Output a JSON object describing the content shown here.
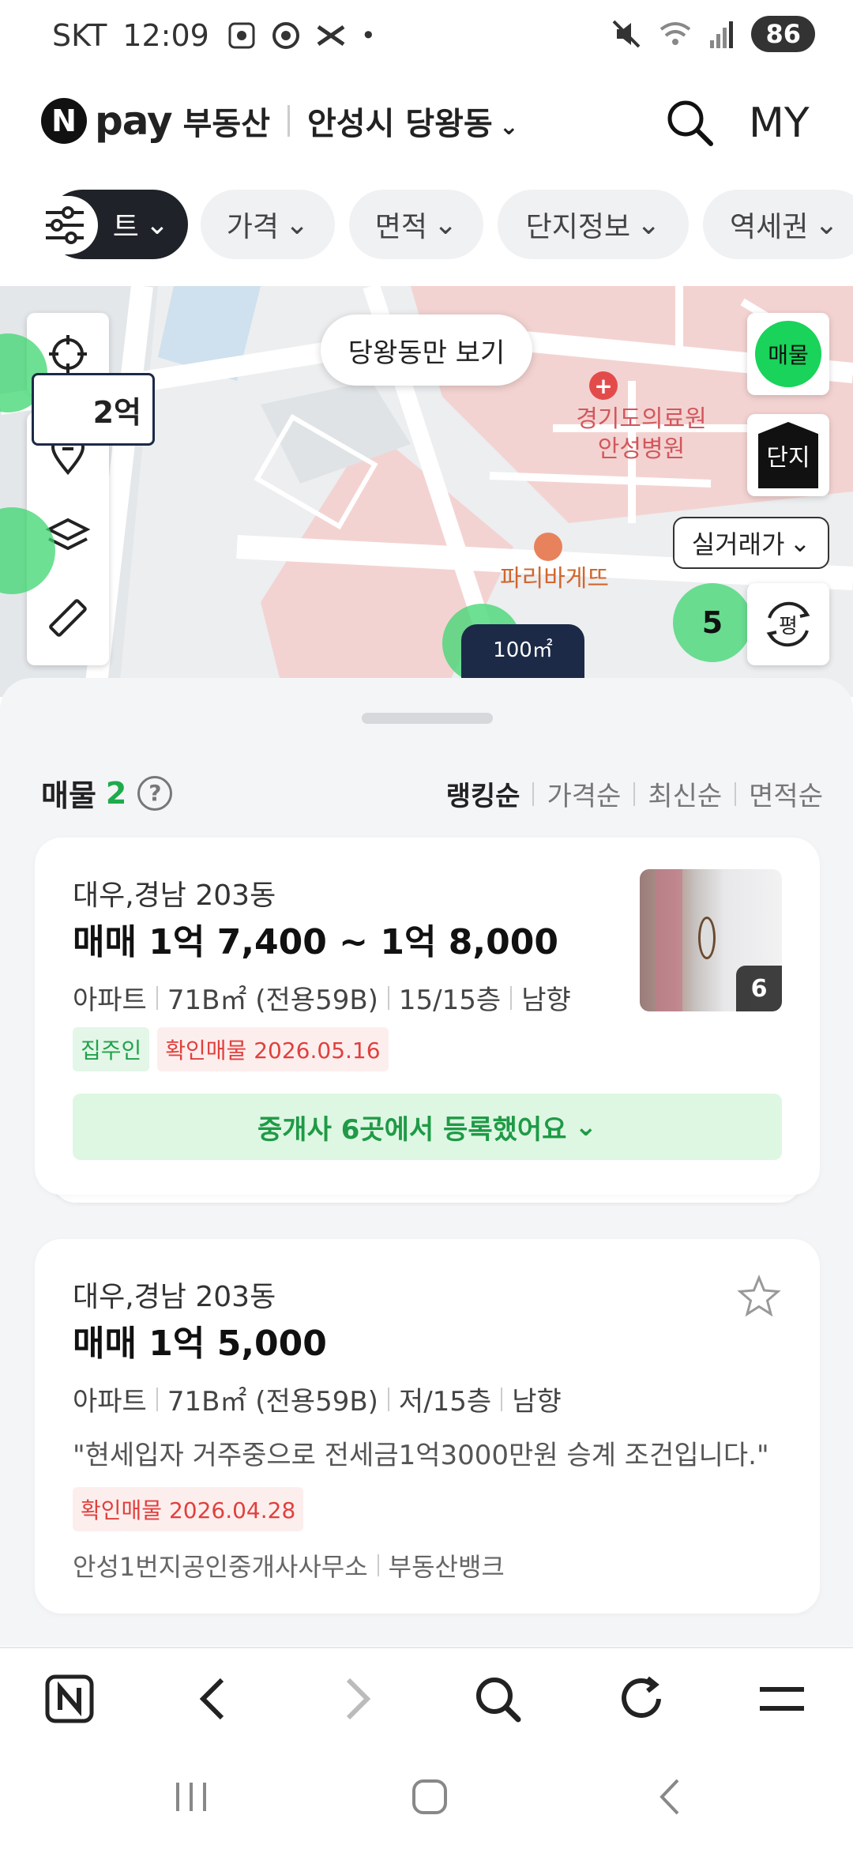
{
  "status_bar": {
    "carrier": "SKT",
    "time": "12:09",
    "battery": "86"
  },
  "header": {
    "logo_letter": "N",
    "brand": "pay",
    "service": "부동산",
    "location": "안성시 당왕동",
    "my": "MY"
  },
  "filters": [
    "트",
    "가격",
    "면적",
    "단지정보",
    "역세권"
  ],
  "map": {
    "view_only": "당왕동만 보기",
    "sale_button": "매물",
    "complex_button": "단지",
    "real_price": "실거래가",
    "pyeong_button": "평",
    "hospital_label": "경기도의료원\n안성병원",
    "bakery_label": "파리바게뜨",
    "cluster_count": "5",
    "marker_area": "100㎡",
    "left_marker_price": "2억"
  },
  "list": {
    "title": "매물",
    "count": "2",
    "sort_options": [
      "랭킹순",
      "가격순",
      "최신순",
      "면적순"
    ],
    "active_sort": "랭킹순"
  },
  "listings": [
    {
      "name": "대우,경남 203동",
      "price": "매매 1억 7,400 ~ 1억 8,000",
      "type": "아파트",
      "area": "71B㎡ (전용59B)",
      "floor": "15/15층",
      "direction": "남향",
      "tags": [
        "집주인",
        "확인매물 2026.05.16"
      ],
      "photo_count": "6",
      "agents": "중개사 6곳에서 등록했어요"
    },
    {
      "name": "대우,경남 203동",
      "price": "매매 1억 5,000",
      "type": "아파트",
      "area": "71B㎡ (전용59B)",
      "floor": "저/15층",
      "direction": "남향",
      "quote": "\"현세입자 거주중으로 전세금1억3000만원 승계 조건입니다.\"",
      "tag": "확인매물 2026.04.28",
      "office": "안성1번지공인중개사사무소",
      "source": "부동산뱅크"
    }
  ],
  "colors": {
    "accent_green": "#19d35a",
    "dark": "#1f2228",
    "red_tag": "#e0403c"
  }
}
